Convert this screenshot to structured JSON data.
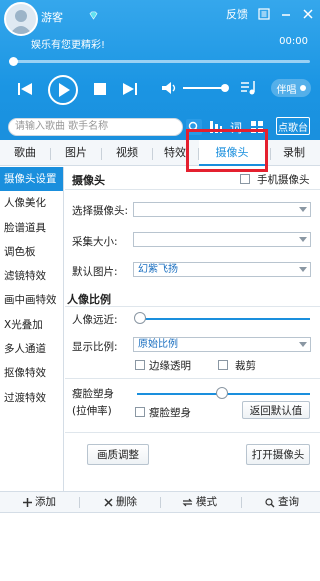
{
  "header": {
    "username": "游客",
    "feedback": "反馈",
    "tagline": "娱乐有您更精彩!",
    "time": "00:00",
    "accompany_label": "伴唱",
    "progress": 0
  },
  "search": {
    "placeholder": "请输入歌曲 歌手名称"
  },
  "console_label": "点歌台",
  "tabs": [
    {
      "label": "歌曲"
    },
    {
      "label": "图片"
    },
    {
      "label": "视频"
    },
    {
      "label": "特效"
    },
    {
      "label": "摄像头"
    },
    {
      "label": "录制"
    }
  ],
  "sidebar": {
    "items": [
      {
        "label": "摄像头设置"
      },
      {
        "label": "人像美化"
      },
      {
        "label": "脸谱道具"
      },
      {
        "label": "调色板"
      },
      {
        "label": "滤镜特效"
      },
      {
        "label": "画中画特效"
      },
      {
        "label": "X光叠加"
      },
      {
        "label": "多人通道"
      },
      {
        "label": "抠像特效"
      },
      {
        "label": "过渡特效"
      }
    ]
  },
  "panel": {
    "camera_title": "摄像头",
    "phone_camera": "手机摄像头",
    "select_camera_label": "选择摄像头:",
    "select_camera_value": "",
    "capture_size_label": "采集大小:",
    "capture_size_value": "",
    "default_image_label": "默认图片:",
    "default_image_value": "幻紫飞扬",
    "portrait_title": "人像比例",
    "portrait_distance_label": "人像远近:",
    "display_ratio_label": "显示比例:",
    "display_ratio_value": "原始比例",
    "edge_transparent": "边缘透明",
    "crop": "裁剪",
    "face_slim_label": "瘦脸塑身",
    "face_slim_sub": "(拉伸率)",
    "face_slim_check": "瘦脸塑身",
    "reset_button": "返回默认值",
    "quality_button": "画质调整",
    "open_camera_button": "打开摄像头"
  },
  "bottom": {
    "add": "添加",
    "delete": "删除",
    "mode": "模式",
    "query": "查询"
  },
  "colors": {
    "accent": "#1a8fdd",
    "header": "#1b95e3",
    "highlight": "#e4202f"
  }
}
